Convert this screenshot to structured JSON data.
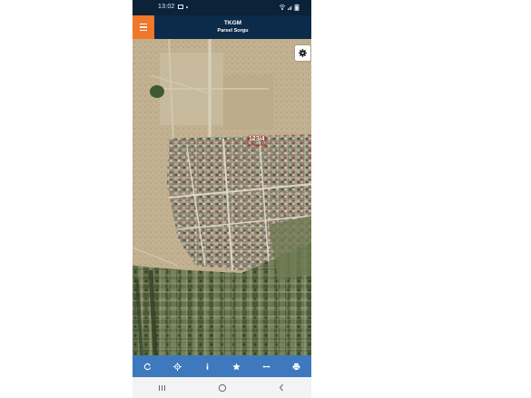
{
  "status_bar": {
    "time": "13:02",
    "icons": [
      "photo-icon",
      "dot-icon",
      "wifi-icon",
      "signal-icon",
      "battery-icon"
    ]
  },
  "header": {
    "title": "TKGM",
    "subtitle": "Parsel Sorgu",
    "menu_icon": "hamburger-icon",
    "accent_color": "#f0782a",
    "background_color": "#0c2a49"
  },
  "map": {
    "view": "satellite",
    "parcel_label": "123/4",
    "settings_icon": "gear-icon"
  },
  "toolbar": {
    "background_color": "#3e79be",
    "buttons": [
      {
        "icon": "refresh-icon"
      },
      {
        "icon": "locate-icon"
      },
      {
        "icon": "info-icon"
      },
      {
        "icon": "star-icon"
      },
      {
        "icon": "measure-icon"
      },
      {
        "icon": "print-icon"
      }
    ]
  },
  "nav_bar": {
    "buttons": [
      {
        "icon": "recent-apps-icon"
      },
      {
        "icon": "home-icon"
      },
      {
        "icon": "back-icon"
      }
    ]
  }
}
